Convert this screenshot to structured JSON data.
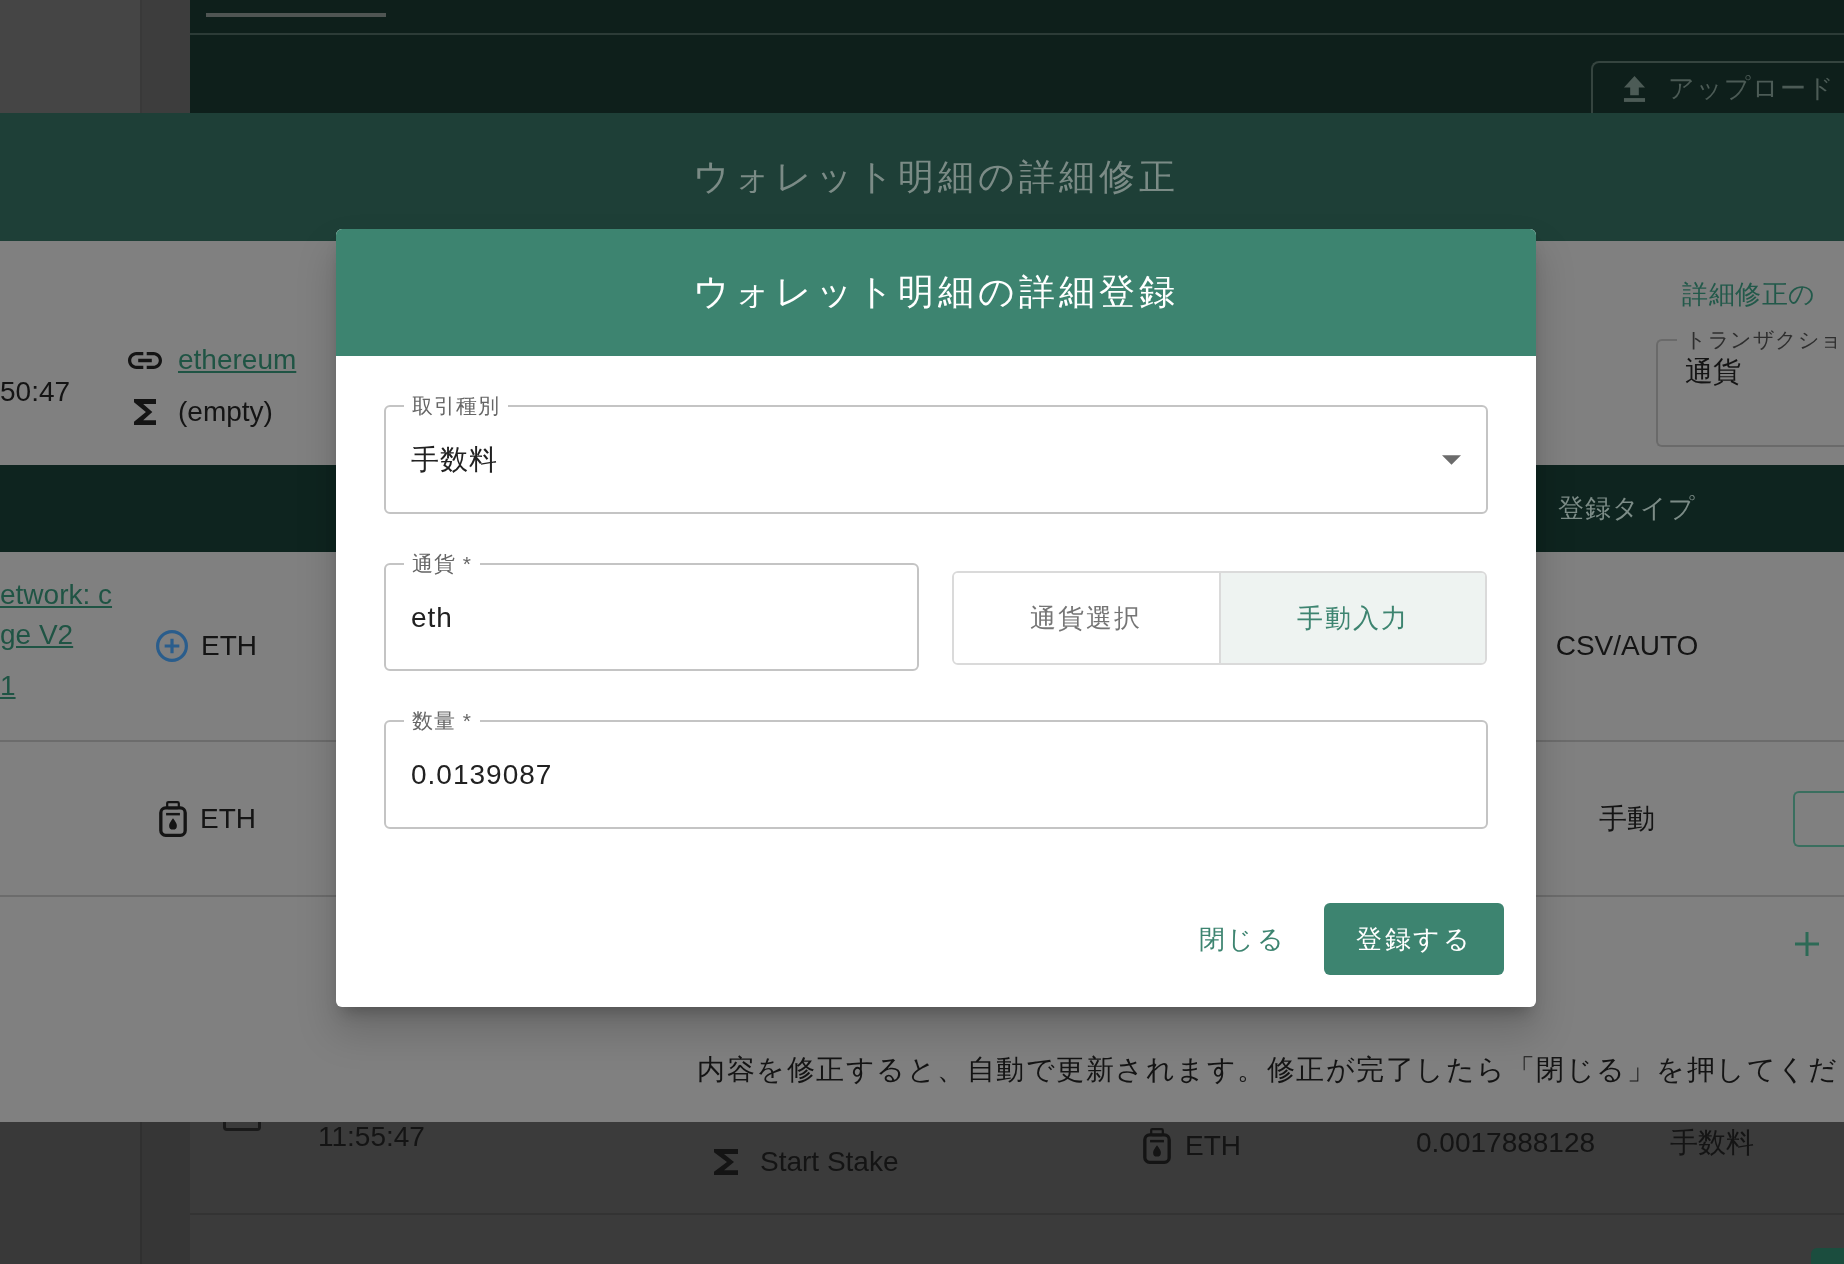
{
  "background_page": {
    "upload_button": {
      "label": "アップロード"
    },
    "rows": [
      {
        "checked": false,
        "time": "11:55:47",
        "memo": "Start Stake",
        "currency": "ETH",
        "amount": "0.0017888128",
        "transaction_type": "手数料"
      }
    ]
  },
  "edit_dialog": {
    "title": "ウォレット明細の詳細修正",
    "summary": {
      "time": "50:47",
      "network": "ethereum",
      "memo": "(empty)"
    },
    "help_heading": "詳細修正の",
    "transaction_field": {
      "label": "トランザクショ",
      "value": "通貨"
    },
    "table": {
      "columns": [
        {
          "label": "登録タイプ"
        }
      ],
      "rows": [
        {
          "kind": "auto",
          "links": [
            "etwork: c",
            "ge V2",
            "1"
          ],
          "currency": "ETH",
          "registration_type": "CSV/AUTO"
        },
        {
          "kind": "manual",
          "currency": "ETH",
          "registration_type": "手動"
        }
      ]
    },
    "notice": "内容を修正すると、自動で更新されます。修正が完了したら「閉じる」を押してくだ"
  },
  "register_dialog": {
    "title": "ウォレット明細の詳細登録",
    "transaction_type": {
      "label": "取引種別",
      "value": "手数料"
    },
    "currency": {
      "label": "通貨 *",
      "value": "eth"
    },
    "currency_mode": [
      {
        "label": "通貨選択",
        "selected": false
      },
      {
        "label": "手動入力",
        "selected": true
      }
    ],
    "amount": {
      "label": "数量 *",
      "value": "0.0139087"
    },
    "buttons": [
      {
        "label": "閉じる",
        "kind": "text"
      },
      {
        "label": "登録する",
        "kind": "primary"
      }
    ]
  }
}
